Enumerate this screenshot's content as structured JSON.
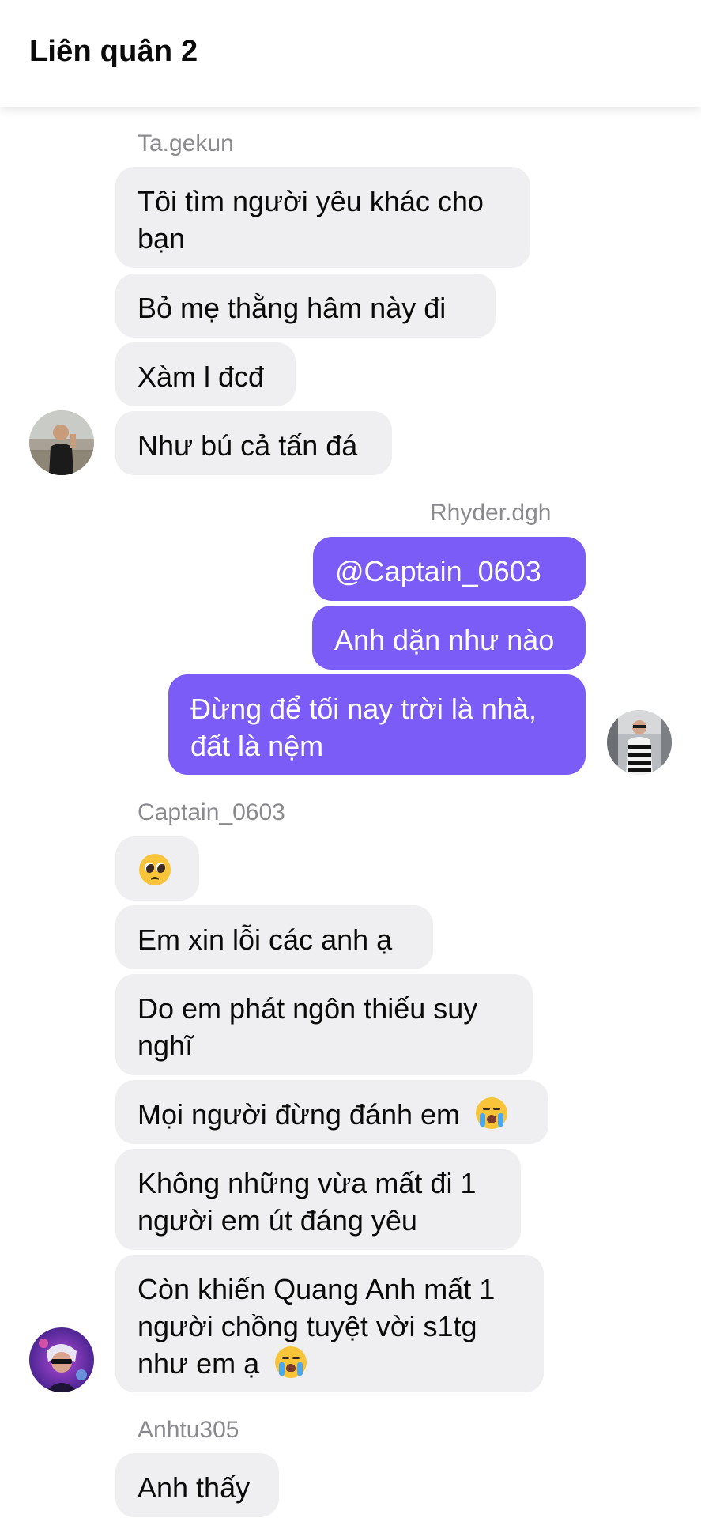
{
  "header": {
    "title": "Liên quân 2"
  },
  "messages": {
    "group1": {
      "sender": "Ta.gekun",
      "m1_line1": "Tôi tìm người yêu khác cho",
      "m1_line2": "bạn",
      "m2": "Bỏ mẹ thằng hâm này đi",
      "m3": "Xàm l đcđ",
      "m4": "Như bú cả tấn đá"
    },
    "group2": {
      "sender": "Rhyder.dgh",
      "m1": "@Captain_0603",
      "m2": "Anh dặn như nào",
      "m3_line1": "Đừng để tối nay trời là nhà,",
      "m3_line2": "đất là nệm"
    },
    "group3": {
      "sender": "Captain_0603",
      "m2": "Em xin lỗi các anh ạ",
      "m3_line1": "Do em phát ngôn thiếu suy",
      "m3_line2": "nghĩ",
      "m4": "Mọi người đừng đánh em",
      "m5_line1": "Không những vừa mất đi 1",
      "m5_line2": "người em út đáng yêu",
      "m6_line1": "Còn khiến Quang Anh mất 1",
      "m6_line2": "người chồng tuyệt vời s1tg",
      "m6_line3": "như em ạ"
    },
    "group4": {
      "sender": "Anhtu305",
      "m1": "Anh thấy"
    }
  },
  "icons": {
    "pleading_emoji": "pleading-face-icon",
    "crying_emoji": "loudly-crying-face-icon"
  },
  "colors": {
    "incoming_bubble": "#efeff1",
    "outgoing_bubble": "#7b5cf6",
    "sender_name": "#8a8a8e"
  }
}
